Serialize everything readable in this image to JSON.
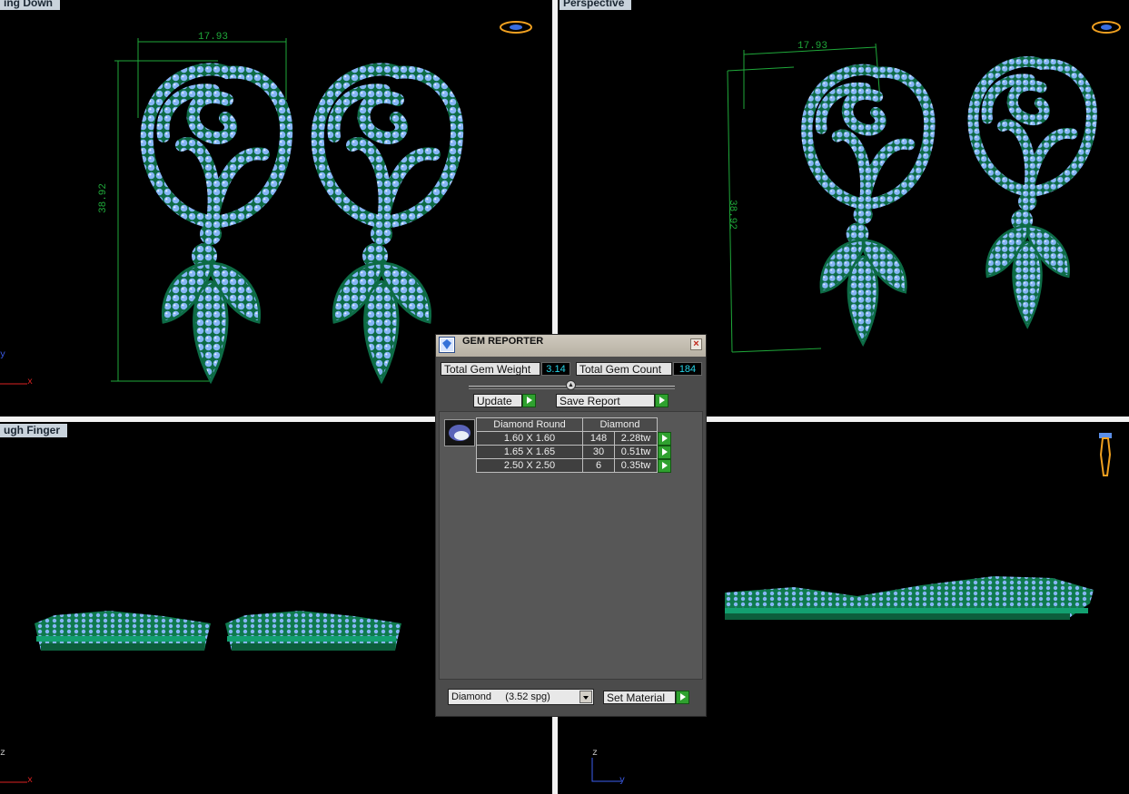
{
  "viewports": {
    "top_left": {
      "label": "ing Down",
      "dim_width": "17.93",
      "dim_height": "38.92"
    },
    "top_right": {
      "label": "Perspective",
      "dim_width": "17.93",
      "dim_height": "38.92"
    },
    "bottom_left": {
      "label": "ugh Finger"
    },
    "bottom_right": {
      "label": ""
    }
  },
  "axes": {
    "x": "x",
    "y": "y",
    "z": "z"
  },
  "gem_reporter": {
    "title": "GEM REPORTER",
    "close_label": "×",
    "total_weight_label": "Total Gem Weight",
    "total_weight_value": "3.14",
    "total_count_label": "Total Gem Count",
    "total_count_value": "184",
    "update_label": "Update",
    "save_report_label": "Save Report",
    "table": {
      "header_shape": "Diamond Round",
      "header_material": "Diamond",
      "rows": [
        {
          "size": "1.60 X 1.60",
          "count": "148",
          "weight": "2.28tw"
        },
        {
          "size": "1.65 X 1.65",
          "count": "30",
          "weight": "0.51tw"
        },
        {
          "size": "2.50 X 2.50",
          "count": "6",
          "weight": "0.35tw"
        }
      ]
    },
    "material_select": "Diamond     (3.52 spg)",
    "set_material_label": "Set Material"
  },
  "colors": {
    "metal": "#0f7a4e",
    "gem": "#7fb0f4",
    "dimension": "#1fa83a",
    "panel": "#4b4b4b"
  }
}
